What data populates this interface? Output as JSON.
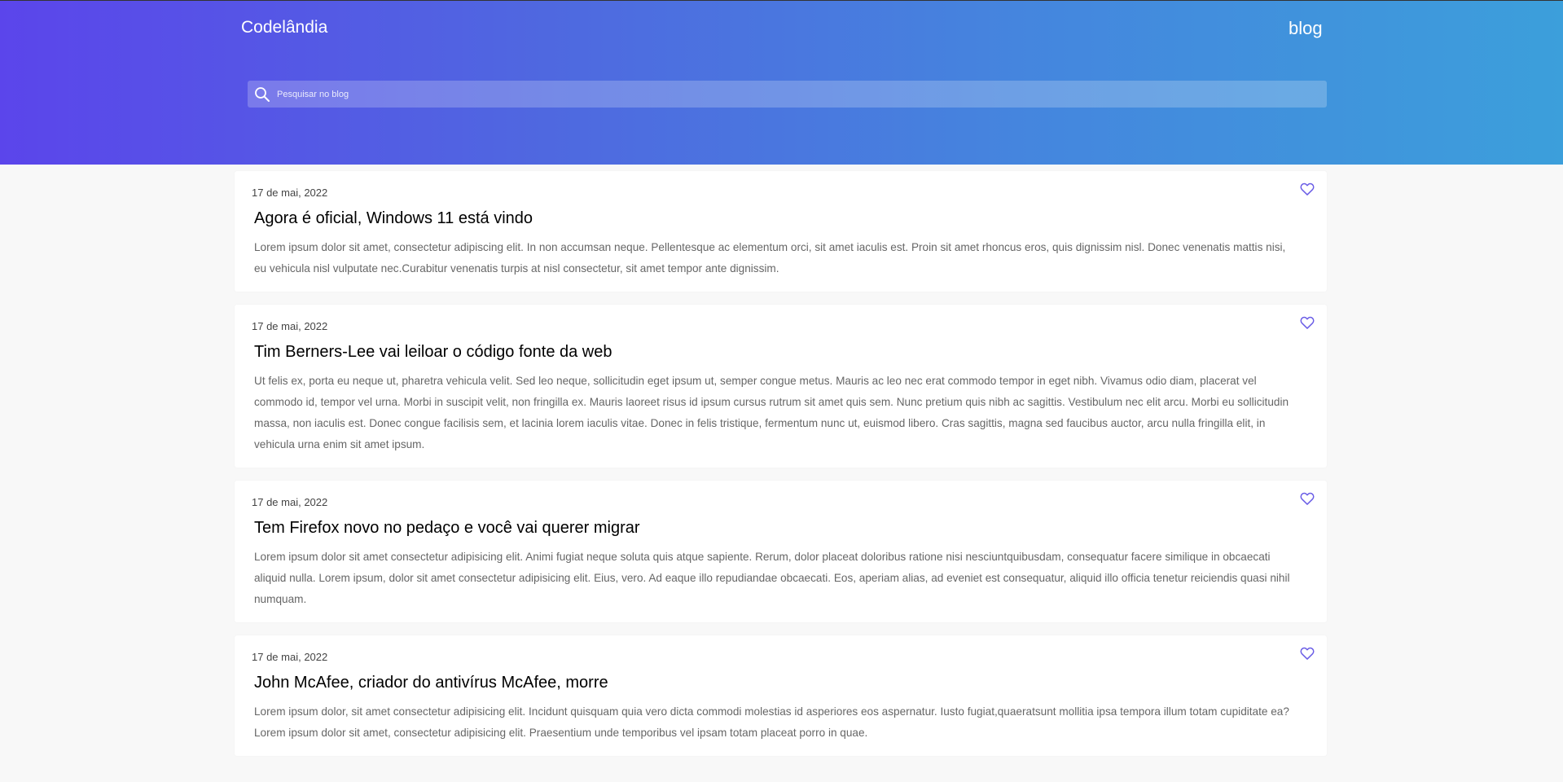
{
  "header": {
    "brand": "Codelândia",
    "nav_link": "blog",
    "search_placeholder": "Pesquisar no blog"
  },
  "colors": {
    "gradient_start": "#5b45eb",
    "gradient_end": "#3c9fdb",
    "heart": "#6a5de6"
  },
  "icons": {
    "search": "search-icon",
    "like": "heart-outline-icon"
  },
  "posts": [
    {
      "date": "17 de mai, 2022",
      "title": "Agora é oficial, Windows 11 está vindo",
      "body": "Lorem ipsum dolor sit amet, consectetur adipiscing elit. In non accumsan neque. Pellentesque ac elementum orci, sit amet iaculis est. Proin sit amet rhoncus eros, quis dignissim nisl. Donec venenatis mattis nisi, eu vehicula nisl vulputate nec.Curabitur venenatis turpis at nisl consectetur, sit amet tempor ante dignissim."
    },
    {
      "date": "17 de mai, 2022",
      "title": "Tim Berners-Lee vai leiloar o código fonte da web",
      "body": "Ut felis ex, porta eu neque ut, pharetra vehicula velit. Sed leo neque, sollicitudin eget ipsum ut, semper congue metus. Mauris ac leo nec erat commodo tempor in eget nibh. Vivamus odio diam, placerat vel commodo id, tempor vel urna. Morbi in suscipit velit, non fringilla ex. Mauris laoreet risus id ipsum cursus rutrum sit amet quis sem. Nunc pretium quis nibh ac sagittis. Vestibulum nec elit arcu. Morbi eu sollicitudin massa, non iaculis est. Donec congue facilisis sem, et lacinia lorem iaculis vitae. Donec in felis tristique, fermentum nunc ut, euismod libero. Cras sagittis, magna sed faucibus auctor, arcu nulla fringilla elit, in vehicula urna enim sit amet ipsum."
    },
    {
      "date": "17 de mai, 2022",
      "title": "Tem Firefox novo no pedaço e você vai querer migrar",
      "body": "Lorem ipsum dolor sit amet consectetur adipisicing elit. Animi fugiat neque soluta quis atque sapiente. Rerum, dolor placeat doloribus ratione nisi nesciuntquibusdam, consequatur facere similique in obcaecati aliquid nulla. Lorem ipsum, dolor sit amet consectetur adipisicing elit. Eius, vero. Ad eaque illo repudiandae obcaecati. Eos, aperiam alias, ad eveniet est consequatur, aliquid illo officia tenetur reiciendis quasi nihil numquam."
    },
    {
      "date": "17 de mai, 2022",
      "title": "John McAfee, criador do antivírus McAfee, morre",
      "body": "Lorem ipsum dolor, sit amet consectetur adipisicing elit. Incidunt quisquam quia vero dicta commodi molestias id asperiores eos aspernatur. Iusto fugiat,quaeratsunt mollitia ipsa tempora illum totam cupiditate ea? Lorem ipsum dolor sit amet, consectetur adipisicing elit. Praesentium unde temporibus vel ipsam totam placeat porro in quae."
    }
  ]
}
